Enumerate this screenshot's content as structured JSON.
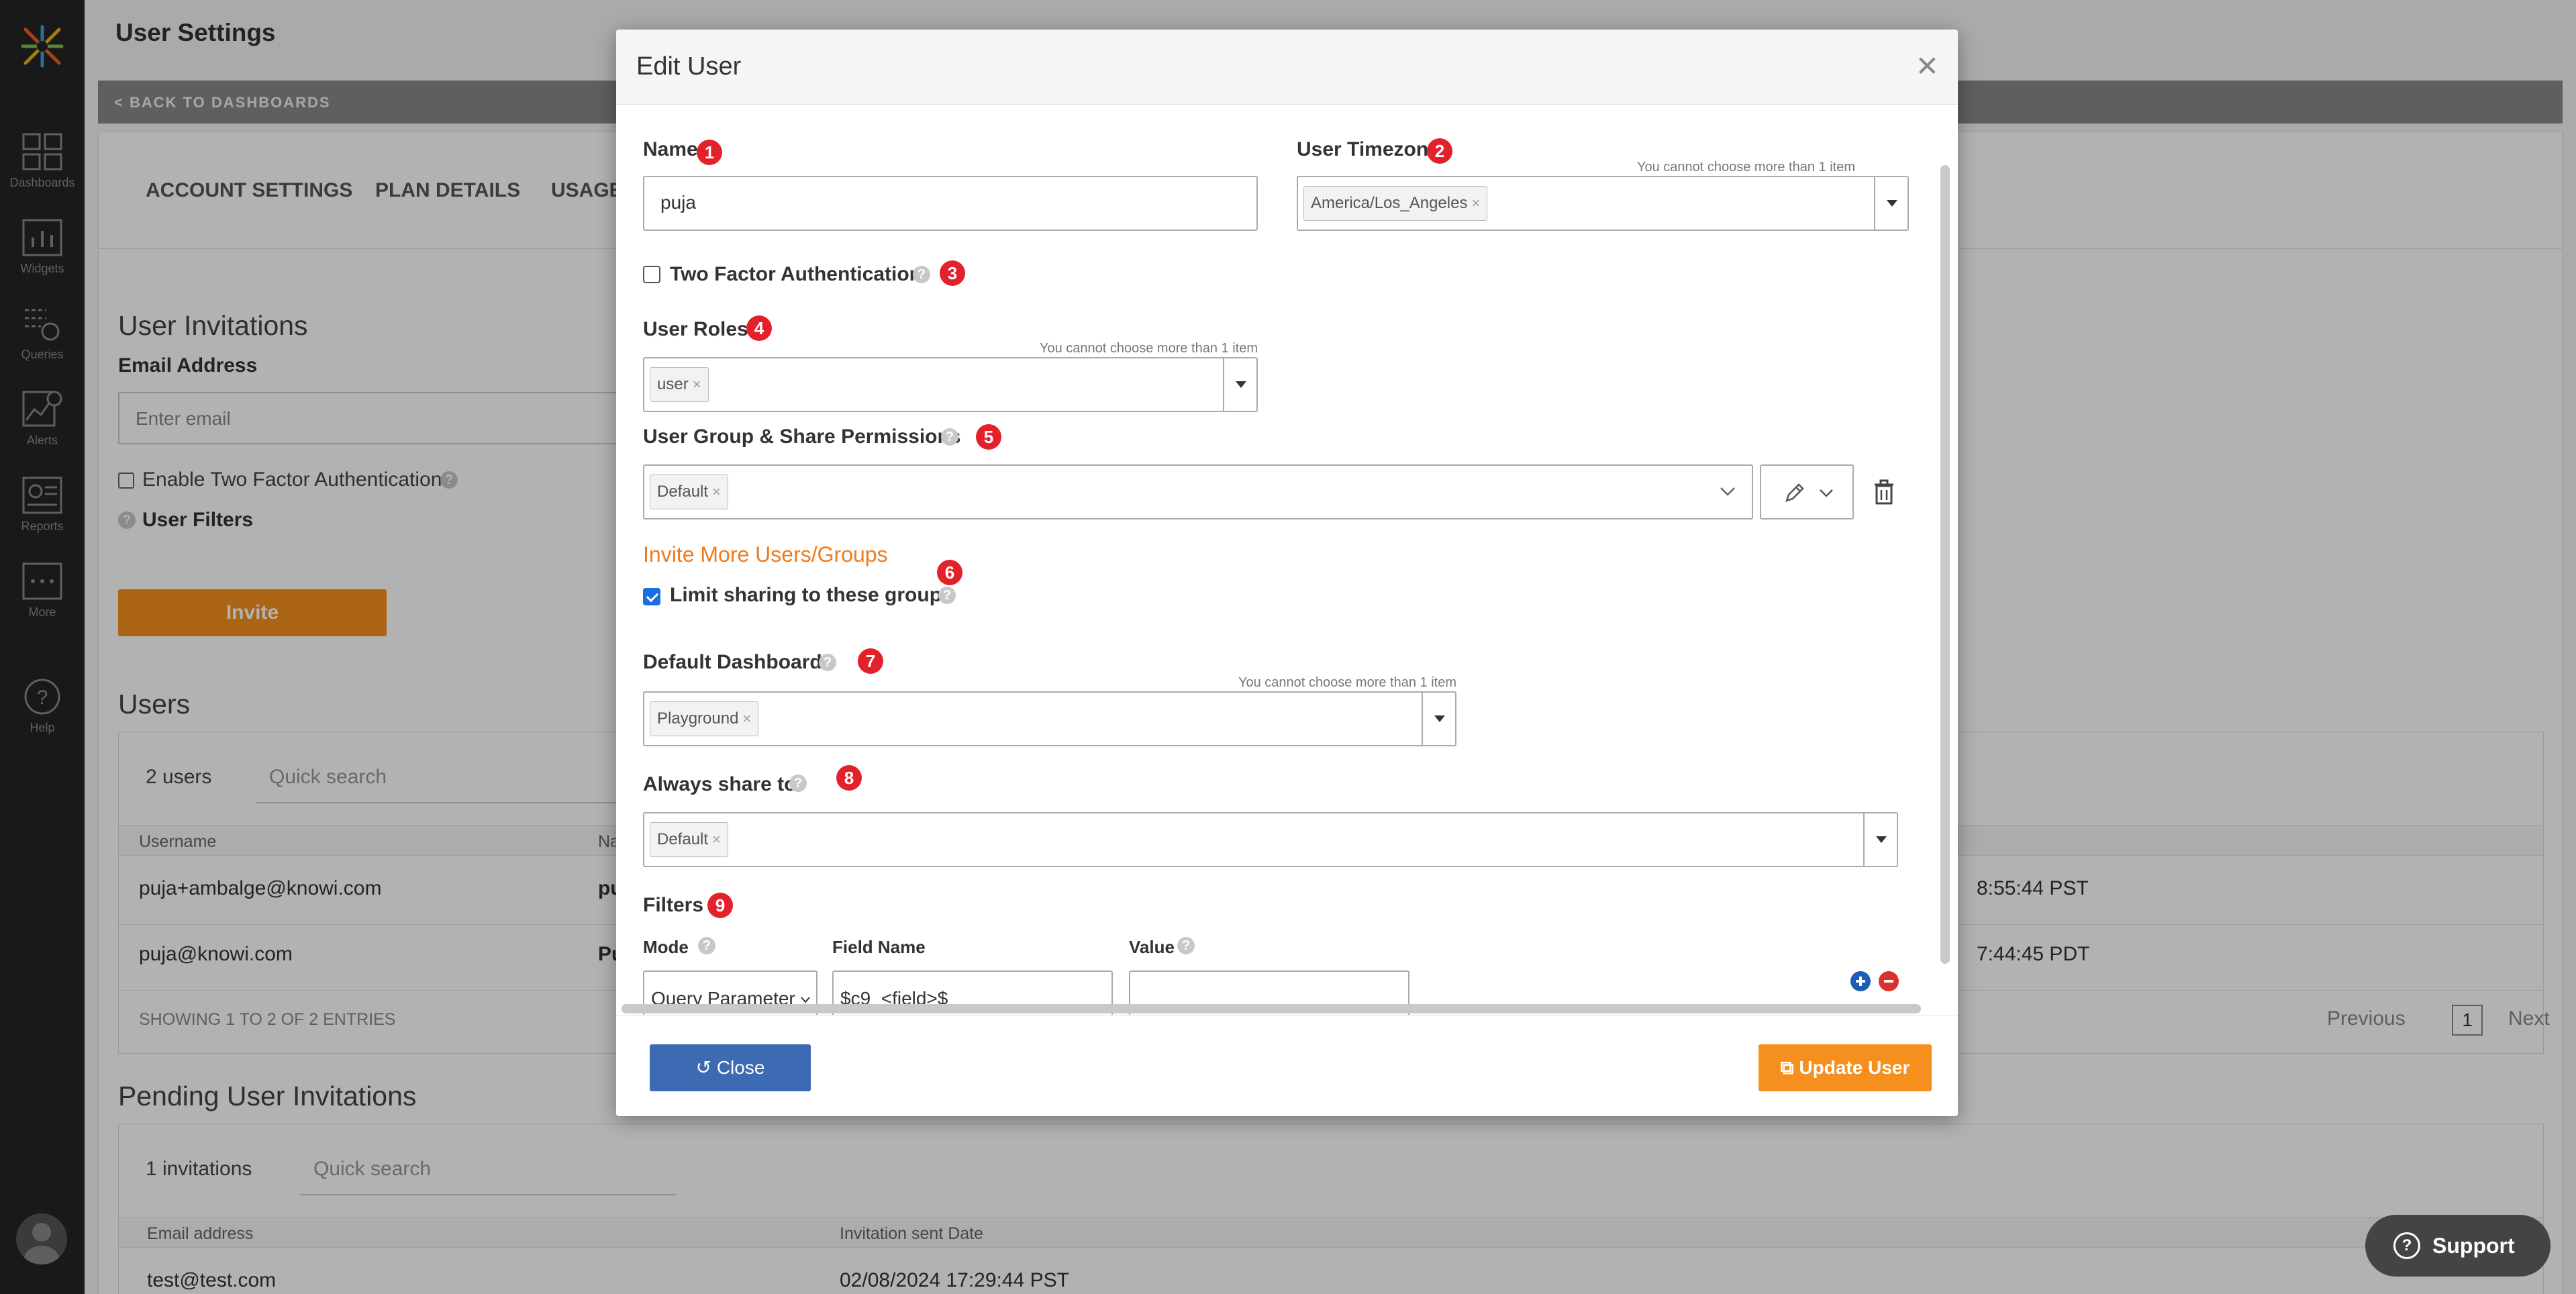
{
  "nav": {
    "items": [
      {
        "label": "Dashboards",
        "icon": "dashboards-icon"
      },
      {
        "label": "Widgets",
        "icon": "widgets-icon"
      },
      {
        "label": "Queries",
        "icon": "queries-icon"
      },
      {
        "label": "Alerts",
        "icon": "alerts-icon"
      },
      {
        "label": "Reports",
        "icon": "reports-icon"
      },
      {
        "label": "More",
        "icon": "more-icon"
      },
      {
        "label": "Help",
        "icon": "help-icon"
      }
    ]
  },
  "page": {
    "title": "User Settings",
    "back_link": "< BACK TO DASHBOARDS",
    "tabs": [
      "ACCOUNT SETTINGS",
      "PLAN DETAILS",
      "USAGE"
    ],
    "invitations": {
      "heading": "User Invitations",
      "email_label": "Email Address",
      "email_placeholder": "Enter email",
      "two_factor_label": "Enable Two Factor Authentication",
      "user_filters_label": "User Filters",
      "invite_button": "Invite"
    },
    "users": {
      "heading": "Users",
      "count": "2 users",
      "search_placeholder": "Quick search",
      "columns": [
        "Username",
        "Na"
      ],
      "rows": [
        {
          "username": "puja+ambalge@knowi.com",
          "name": "pu",
          "time": "8:55:44 PST"
        },
        {
          "username": "puja@knowi.com",
          "name": "Pu",
          "time": "7:44:45 PDT"
        }
      ],
      "entries": "SHOWING 1 TO 2 OF 2 ENTRIES",
      "prev": "Previous",
      "page": "1",
      "next": "Next"
    },
    "pending": {
      "heading": "Pending User Invitations",
      "count": "1 invitations",
      "search_placeholder": "Quick search",
      "columns": [
        "Email address",
        "Invitation sent Date"
      ],
      "rows": [
        {
          "email": "test@test.com",
          "date": "02/08/2024 17:29:44 PST"
        }
      ]
    }
  },
  "modal": {
    "title": "Edit User",
    "name": {
      "label": "Name",
      "badge": "1",
      "value": "puja"
    },
    "timezone": {
      "label": "User Timezone",
      "badge": "2",
      "hint": "You cannot choose more than 1 item",
      "tag": "America/Los_Angeles"
    },
    "two_factor": {
      "label": "Two Factor Authentication",
      "badge": "3",
      "checked": false
    },
    "roles": {
      "label": "User Roles",
      "badge": "4",
      "hint": "You cannot choose more than 1 item",
      "tag": "user"
    },
    "group_perms": {
      "label": "User Group & Share Permissions",
      "badge": "5",
      "tag": "Default"
    },
    "invite_more": {
      "label": "Invite More Users/Groups",
      "badge": "6"
    },
    "limit_sharing": {
      "label": "Limit sharing to these groups",
      "checked": true
    },
    "default_dashboard": {
      "label": "Default Dashboard",
      "badge": "7",
      "hint": "You cannot choose more than 1 item",
      "tag": "Playground"
    },
    "always_share": {
      "label": "Always share to",
      "badge": "8",
      "tag": "Default"
    },
    "filters": {
      "label": "Filters",
      "badge": "9",
      "mode_label": "Mode",
      "field_label": "Field Name",
      "value_label": "Value",
      "mode_value": "Query Parameter",
      "field_value": "$c9_<field>$",
      "value_value": ""
    },
    "close_button": "Close",
    "update_button": "Update User"
  },
  "support": {
    "label": "Support"
  },
  "colors": {
    "badge": "#e3212a",
    "orange": "#f07a1a",
    "primary": "#3d6bb3",
    "update": "#f5901e",
    "rail": "#242424"
  }
}
